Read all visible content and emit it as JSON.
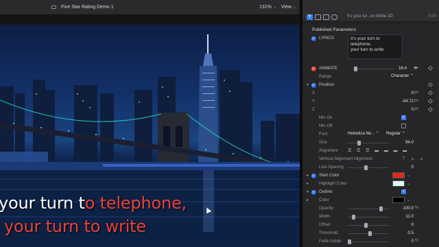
{
  "viewer": {
    "doc_title": "Five Star Rating Demo 1",
    "zoom": "131%",
    "view_label": "View",
    "lyric_line1_sung": "your turn t",
    "lyric_line1_unsung": "o telephone,",
    "lyric_line2": "your turn to write",
    "sung_color": "#ffffff",
    "unsung_color": "#e8423d"
  },
  "inspector": {
    "clip_name": "It's your tur...ck-White 3D",
    "duration": "5;00",
    "section_title": "Published Parameters",
    "lyrics_label": "LYRICS",
    "lyrics_text": [
      "It's your turn to",
      "telephone,",
      "your turn to write"
    ],
    "animate": {
      "label": "ANIMATE",
      "value": "16.4"
    },
    "range": {
      "label": "Range",
      "value": "Character"
    },
    "position": {
      "label": "Position",
      "x_label": "X",
      "x": "0",
      "y_label": "Y",
      "y": "-34.72",
      "z_label": "Z",
      "z": "0",
      "unit": "px"
    },
    "mix_on": {
      "label": "Mix On",
      "checked": true
    },
    "mix_off": {
      "label": "Mix Off",
      "checked": false
    },
    "font": {
      "label": "Font",
      "family": "Helvetica Ne...",
      "style": "Regular"
    },
    "size": {
      "label": "Size",
      "value": "94.0"
    },
    "alignment": {
      "label": "Alignment"
    },
    "vertical_alignment": {
      "label": "Vertical Alignment Alignment"
    },
    "line_spacing": {
      "label": "Line Spacing",
      "value": "0"
    },
    "start_color": {
      "label": "Start Color",
      "color": "#e02a1f"
    },
    "highlight_color": {
      "label": "Highlight Color",
      "color": "#dffaf5"
    },
    "outline": {
      "label": "Outline",
      "checked": true
    },
    "color": {
      "label": "Color",
      "color": "#000000"
    },
    "opacity": {
      "label": "Opacity",
      "value": "100.0",
      "unit": "%"
    },
    "width": {
      "label": "Width",
      "value": "11.0"
    },
    "offset": {
      "label": "Offset",
      "value": "0"
    },
    "threshold": {
      "label": "Threshold",
      "value": "0.5"
    },
    "fade_inside": {
      "label": "Fade Inside",
      "value": "0",
      "unit": "%"
    }
  },
  "icons": [
    "doc-icon",
    "text-inspector-icon",
    "film-icon",
    "grid-icon",
    "info-icon",
    "keyframe-icon",
    "disclosure-triangle-icon",
    "parameter-dot-icon"
  ]
}
